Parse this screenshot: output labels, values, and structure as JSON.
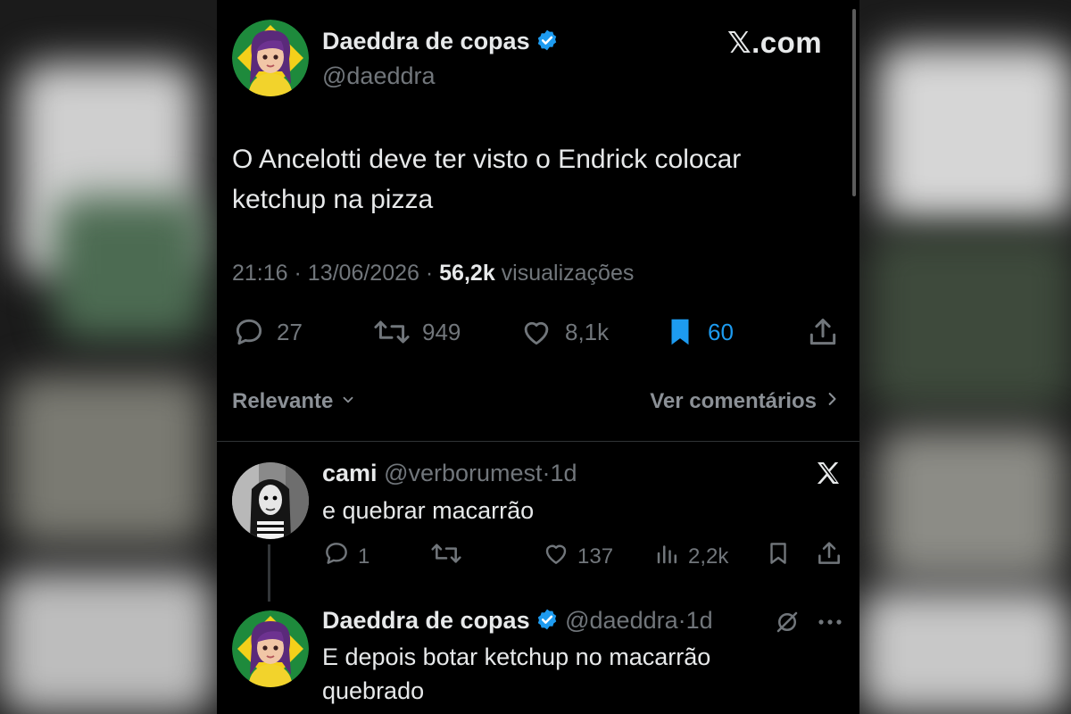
{
  "colors": {
    "background": "#000000",
    "text": "#e7e9ea",
    "muted": "#71767b",
    "accent": "#1d9bf0"
  },
  "brand": "𝕏.com",
  "main_tweet": {
    "author_name": "Daeddra de copas",
    "author_handle": "@daeddra",
    "text": "O Ancelotti deve ter visto o Endrick colocar ketchup na pizza",
    "time": "21:16",
    "date": "13/06/2026",
    "views_count": "56,2k",
    "views_label": "visualizações",
    "stats": {
      "replies": "27",
      "retweets": "949",
      "likes": "8,1k",
      "bookmarks": "60"
    }
  },
  "comments_bar": {
    "sort_label": "Relevante",
    "see_comments_label": "Ver comentários"
  },
  "replies": [
    {
      "author_name": "cami",
      "author_handle": "@verborumest",
      "age": "1d",
      "text": "e quebrar macarrão",
      "stats": {
        "replies": "1",
        "retweets": "",
        "likes": "137",
        "views": "2,2k"
      }
    },
    {
      "author_name": "Daeddra de copas",
      "author_handle": "@daeddra",
      "age": "1d",
      "text": "E depois botar ketchup no macarrão quebrado"
    }
  ],
  "icons": [
    "verified-badge-icon",
    "reply-icon",
    "retweet-icon",
    "like-icon",
    "bookmark-icon",
    "share-icon",
    "views-icon",
    "chevron-down-icon",
    "chevron-right-icon",
    "x-logo-icon",
    "grok-icon",
    "more-icon"
  ]
}
